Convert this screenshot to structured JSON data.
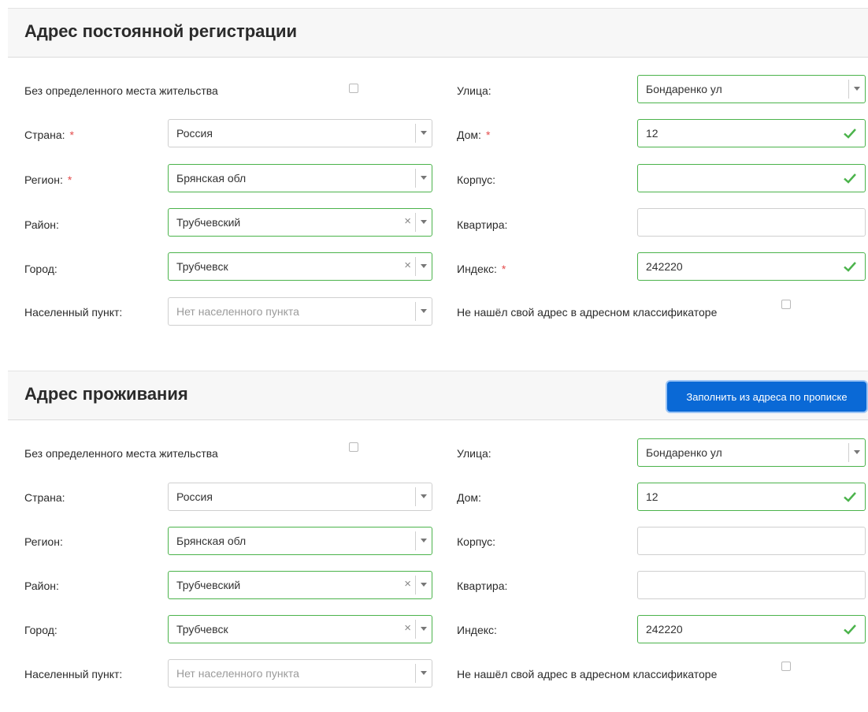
{
  "registration": {
    "title": "Адрес постоянной регистрации",
    "no_fixed_residence_label": "Без определенного места жительства",
    "country": {
      "label": "Страна:",
      "value": "Россия"
    },
    "region": {
      "label": "Регион:",
      "value": "Брянская обл"
    },
    "district": {
      "label": "Район:",
      "value": "Трубчевский"
    },
    "city": {
      "label": "Город:",
      "value": "Трубчевск"
    },
    "settlement": {
      "label": "Населенный пункт:",
      "placeholder": "Нет населенного пункта"
    },
    "street": {
      "label": "Улица:",
      "value": "Бондаренко ул"
    },
    "house": {
      "label": "Дом:",
      "value": "12"
    },
    "building": {
      "label": "Корпус:",
      "value": ""
    },
    "apartment": {
      "label": "Квартира:",
      "value": ""
    },
    "postcode": {
      "label": "Индекс:",
      "value": "242220"
    },
    "not_found_label": "Не нашёл свой адрес в адресном классификаторе"
  },
  "residence": {
    "title": "Адрес проживания",
    "fill_button": "Заполнить из адреса по прописке",
    "no_fixed_residence_label": "Без определенного места жительства",
    "country": {
      "label": "Страна:",
      "value": "Россия"
    },
    "region": {
      "label": "Регион:",
      "value": "Брянская обл"
    },
    "district": {
      "label": "Район:",
      "value": "Трубчевский"
    },
    "city": {
      "label": "Город:",
      "value": "Трубчевск"
    },
    "settlement": {
      "label": "Населенный пункт:",
      "placeholder": "Нет населенного пункта"
    },
    "street": {
      "label": "Улица:",
      "value": "Бондаренко ул"
    },
    "house": {
      "label": "Дом:",
      "value": "12"
    },
    "building": {
      "label": "Корпус:",
      "value": ""
    },
    "apartment": {
      "label": "Квартира:",
      "value": ""
    },
    "postcode": {
      "label": "Индекс:",
      "value": "242220"
    },
    "not_found_label": "Не нашёл свой адрес в адресном классификаторе"
  },
  "common": {
    "required_mark": "*",
    "clear_glyph": "×"
  },
  "colors": {
    "valid": "#4bb34b",
    "required": "#e44c4c",
    "accent": "#0a69d6"
  },
  "icons": {
    "valid": "check-icon",
    "dropdown": "chevron-down-icon",
    "clear": "close-icon"
  }
}
